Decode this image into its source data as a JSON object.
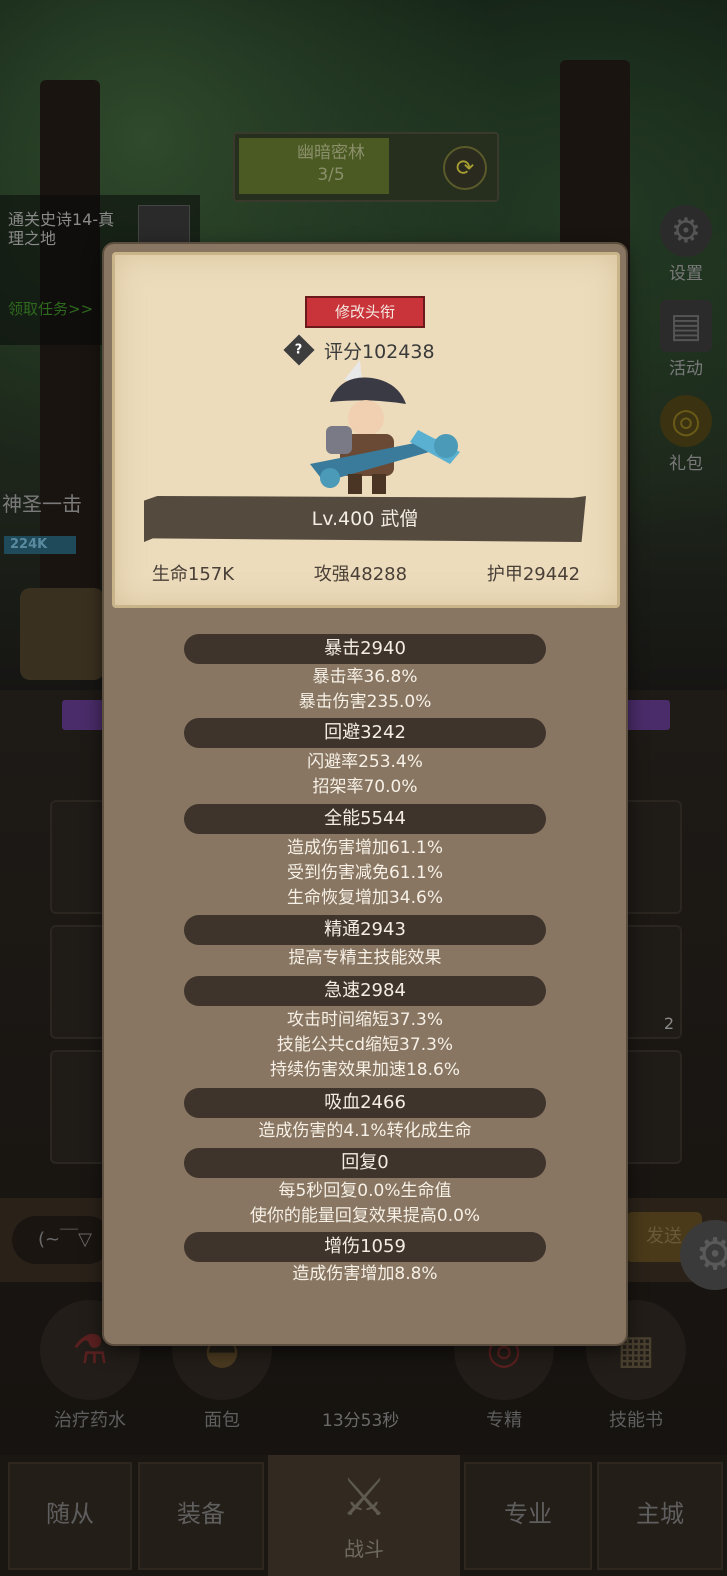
{
  "background": {
    "stage": {
      "name": "幽暗密林",
      "progress": "3/5"
    },
    "quest": {
      "title": "通关史诗14-真理之地",
      "link": "领取任务>>"
    },
    "side_buttons": [
      {
        "label": "设置",
        "icon": "gear-icon"
      },
      {
        "label": "活动",
        "icon": "scroll-icon"
      },
      {
        "label": "礼包",
        "icon": "gift-icon"
      }
    ],
    "skill_name": "神圣一击",
    "hp_value": "224K",
    "chat_input": "(~￣▽",
    "send_label": "发送",
    "items": [
      {
        "label": "治疗药水",
        "icon": "potion-icon"
      },
      {
        "label": "面包",
        "icon": "bread-icon"
      },
      {
        "label": "专精",
        "icon": "target-icon"
      },
      {
        "label": "技能书",
        "icon": "book-icon"
      }
    ],
    "timer": "13分53秒",
    "slot_badge": "2",
    "nav": {
      "tab1": "随从",
      "tab2": "装备",
      "center": "战斗",
      "tab4": "专业",
      "tab5": "主城"
    }
  },
  "panel": {
    "title_button": "修改头衔",
    "score": "评分102438",
    "level": "Lv.400 武僧",
    "core": {
      "hp": "生命157K",
      "attack": "攻强48288",
      "armor": "护甲29442"
    },
    "stats": [
      {
        "header": "暴击2940",
        "lines": [
          "暴击率36.8%",
          "暴击伤害235.0%"
        ]
      },
      {
        "header": "回避3242",
        "lines": [
          "闪避率253.4%",
          "招架率70.0%"
        ]
      },
      {
        "header": "全能5544",
        "lines": [
          "造成伤害增加61.1%",
          "受到伤害减免61.1%",
          "生命恢复增加34.6%"
        ]
      },
      {
        "header": "精通2943",
        "lines": [
          "提高专精主技能效果"
        ]
      },
      {
        "header": "急速2984",
        "lines": [
          "攻击时间缩短37.3%",
          "技能公共cd缩短37.3%",
          "持续伤害效果加速18.6%"
        ]
      },
      {
        "header": "吸血2466",
        "lines": [
          "造成伤害的4.1%转化成生命"
        ]
      },
      {
        "header": "回复0",
        "lines": [
          "每5秒回复0.0%生命值",
          "使你的能量回复效果提高0.0%"
        ]
      },
      {
        "header": "增伤1059",
        "lines": [
          "造成伤害增加8.8%"
        ]
      }
    ]
  },
  "colors": {
    "title_button": "#c9333a",
    "panel": "#887662",
    "card": "#ecdcbc",
    "pill": "#3e342b"
  }
}
